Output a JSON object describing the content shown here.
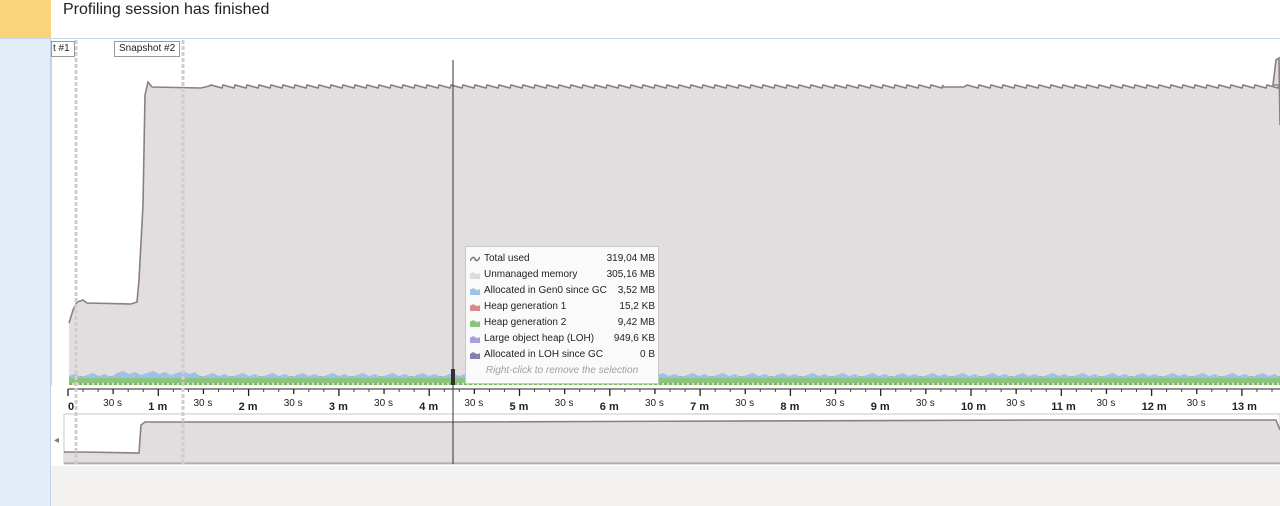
{
  "banner": {
    "message": "Profiling session has finished"
  },
  "snapshots": [
    {
      "label": "t #1"
    },
    {
      "label": "Snapshot #2"
    }
  ],
  "axis": {
    "major_labels": [
      "0",
      "1 m",
      "2 m",
      "3 m",
      "4 m",
      "5 m",
      "6 m",
      "7 m",
      "8 m",
      "9 m",
      "10 m",
      "11 m",
      "12 m",
      "13 m"
    ],
    "minor_label": "30 s"
  },
  "tooltip": {
    "rows": [
      {
        "label": "Total used",
        "value": "319,04 MB",
        "icon": "line-icon",
        "color": "#7a6f73"
      },
      {
        "label": "Unmanaged memory",
        "value": "305,16 MB",
        "icon": "area-icon",
        "color": "#dcdcdc"
      },
      {
        "label": "Allocated in Gen0 since GC",
        "value": "3,52 MB",
        "icon": "area-icon",
        "color": "#9ec2e6"
      },
      {
        "label": "Heap generation 1",
        "value": "15,2 KB",
        "icon": "area-icon",
        "color": "#d88a8a"
      },
      {
        "label": "Heap generation 2",
        "value": "9,42 MB",
        "icon": "area-icon",
        "color": "#8cc47e"
      },
      {
        "label": "Large object heap (LOH)",
        "value": "949,6 KB",
        "icon": "area-icon",
        "color": "#a99ed8"
      },
      {
        "label": "Allocated in LOH since GC",
        "value": "0 B",
        "icon": "area-icon",
        "color": "#8a7fae"
      }
    ],
    "hint": "Right-click to remove the selection"
  },
  "colors": {
    "memory_fill": "#e2dedf",
    "total_line": "#8a7f83",
    "gen2_fill": "#8cc47e",
    "gen0_fill": "#9ec2e6",
    "banner_accent": "#fbd37a"
  }
}
